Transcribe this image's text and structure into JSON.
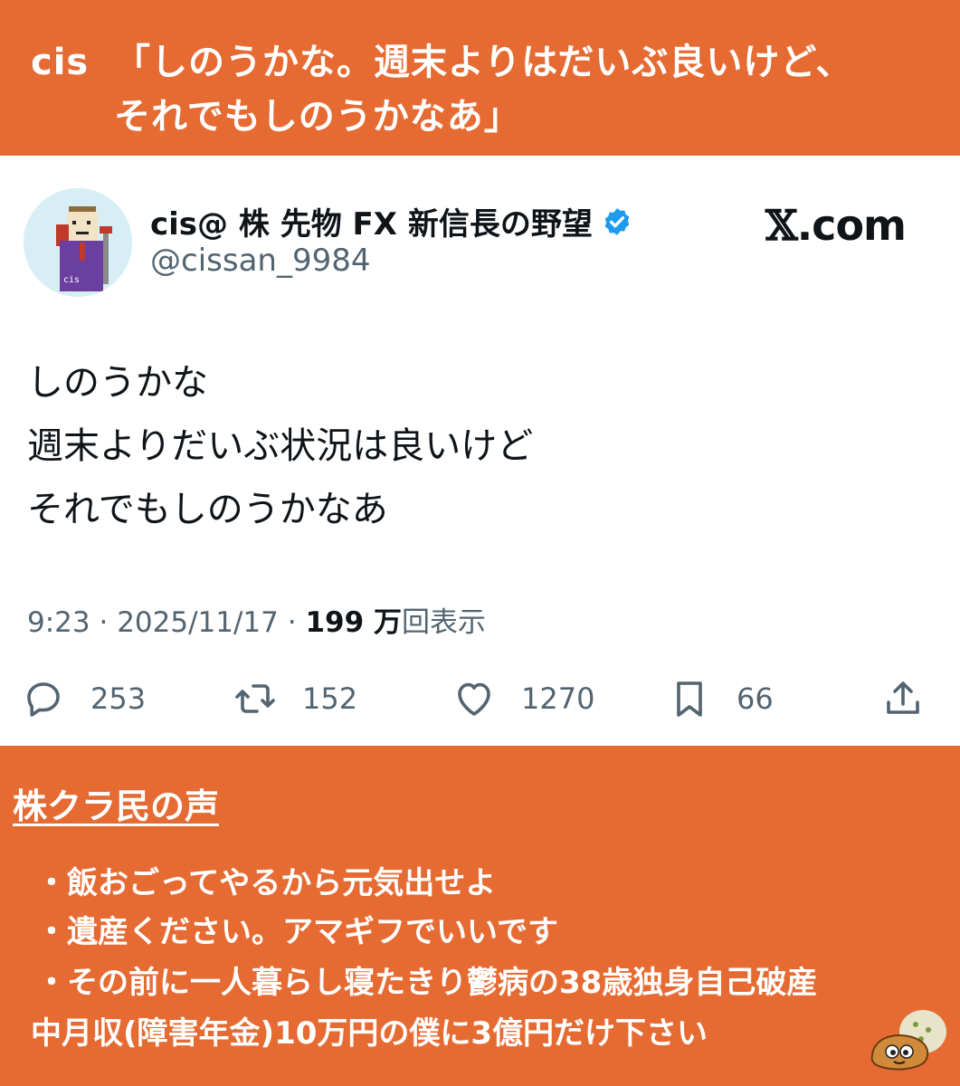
{
  "header": {
    "line1_prefix": "cis",
    "line1_text": "「しのうかな。週末よりはだいぶ良いけど、",
    "line2_text": "それでもしのうかなあ」"
  },
  "tweet": {
    "display_name": "cis@ 株 先物 FX 新信長の野望",
    "handle": "@cissan_9984",
    "brand": {
      "glyph": "𝕏",
      "suffix": ".com"
    },
    "lines": [
      "しのうかな",
      "週末よりだいぶ状況は良いけど",
      "それでもしのうかなあ"
    ],
    "time": "9:23",
    "separator": " · ",
    "date": "2025/11/17",
    "views_number": "199 万",
    "views_label": "回表示",
    "actions": {
      "replies": "253",
      "retweets": "152",
      "likes": "1270",
      "bookmarks": "66"
    },
    "icons": [
      "avatar",
      "verified-badge-icon",
      "reply-icon",
      "retweet-icon",
      "like-icon",
      "bookmark-icon",
      "share-icon"
    ],
    "colors": {
      "verified": "#1D9BF0",
      "text": "#0F1419",
      "muted": "#536471"
    }
  },
  "voices": {
    "title": "株クラ民の声",
    "comments": [
      "・飯おごってやるから元気出せよ",
      "・遺産ください。アマギフでいいです",
      "・その前に一人暮らし寝たきり鬱病の38歳独身自己破産",
      "中月収(障害年金)10万円の僕に3億円だけ下さい"
    ]
  },
  "colors": {
    "accent": "#E56B33",
    "card": "#FFFFFF"
  }
}
